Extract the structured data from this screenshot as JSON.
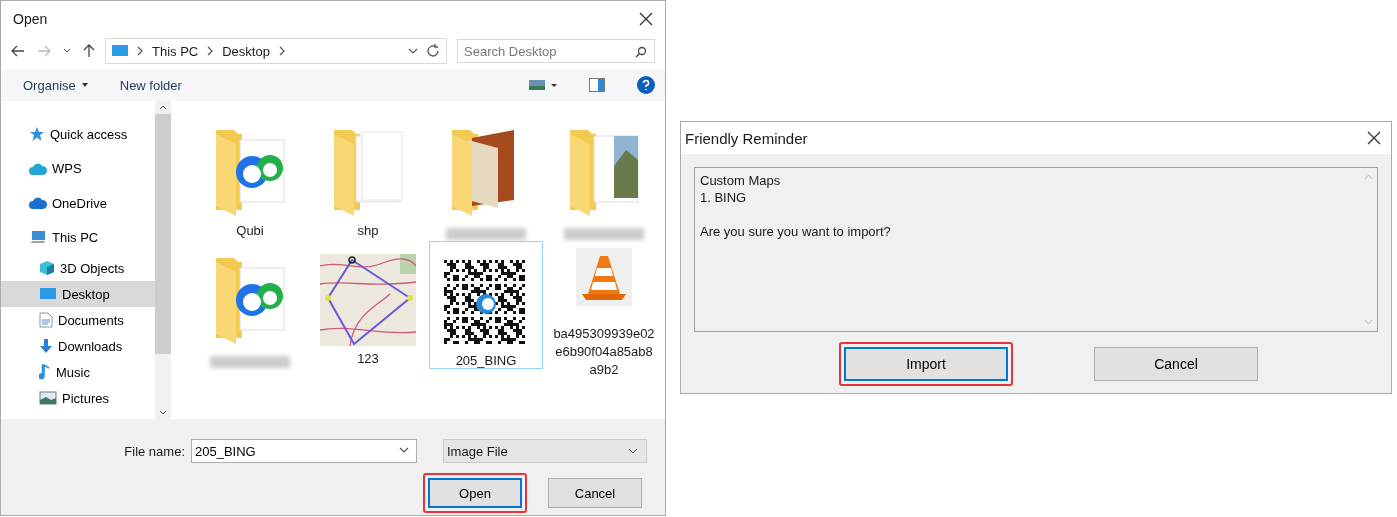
{
  "open_dialog": {
    "title": "Open",
    "breadcrumbs": [
      "This PC",
      "Desktop"
    ],
    "search": {
      "placeholder": "Search Desktop"
    },
    "toolbar": {
      "organise": "Organise",
      "new_folder": "New folder"
    },
    "sidebar": {
      "items": [
        {
          "label": "Quick access",
          "kind": "star",
          "selected": false
        },
        {
          "label": "WPS",
          "kind": "cloud",
          "selected": false
        },
        {
          "label": "OneDrive",
          "kind": "onedrive",
          "selected": false
        },
        {
          "label": "This PC",
          "kind": "pc",
          "selected": false,
          "children": [
            {
              "label": "3D Objects",
              "kind": "cube",
              "selected": false
            },
            {
              "label": "Desktop",
              "kind": "desktop",
              "selected": true
            },
            {
              "label": "Documents",
              "kind": "document",
              "selected": false
            },
            {
              "label": "Downloads",
              "kind": "download",
              "selected": false
            },
            {
              "label": "Music",
              "kind": "music",
              "selected": false
            },
            {
              "label": "Pictures",
              "kind": "pictures",
              "selected": false
            }
          ]
        }
      ]
    },
    "files": [
      {
        "label": "Qubi",
        "kind": "logofolder",
        "selected": false
      },
      {
        "label": "shp",
        "kind": "blankfolder",
        "selected": false
      },
      {
        "kind": "woodfolder",
        "selected": false
      },
      {
        "kind": "photofolder",
        "selected": false
      },
      {
        "kind": "logofolder",
        "selected": false
      },
      {
        "label": "123",
        "kind": "map",
        "selected": false
      },
      {
        "label": "205_BING",
        "kind": "qr",
        "selected": true
      },
      {
        "label": "ba495309939e02e6b90f04a85ab8a9b2",
        "kind": "cone",
        "selected": false
      }
    ],
    "file_name": {
      "label": "File name:",
      "value": "205_BING"
    },
    "file_type": "Image File",
    "buttons": [
      {
        "label": "Open",
        "default": true,
        "highlighted": true
      },
      {
        "label": "Cancel",
        "default": false,
        "highlighted": false
      }
    ]
  },
  "reminder_dialog": {
    "title": "Friendly Reminder",
    "lines": [
      "Custom Maps",
      "1. BING"
    ],
    "question": "Are you sure you want to import?",
    "buttons": [
      {
        "label": "Import",
        "default": true,
        "highlighted": true
      },
      {
        "label": "Cancel",
        "default": false,
        "highlighted": false
      }
    ]
  }
}
